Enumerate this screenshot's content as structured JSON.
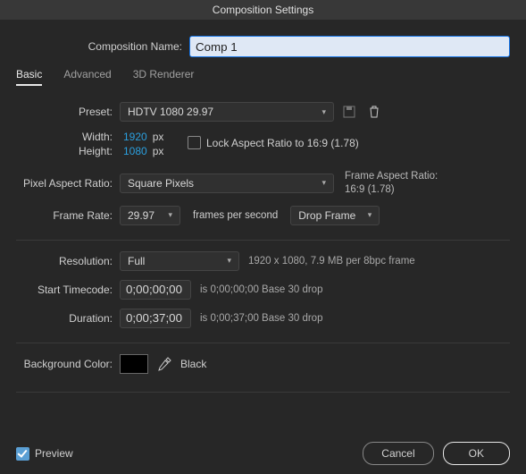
{
  "title": "Composition Settings",
  "compNameLabel": "Composition Name:",
  "compName": "Comp 1",
  "tabs": {
    "basic": "Basic",
    "advanced": "Advanced",
    "renderer": "3D Renderer"
  },
  "preset": {
    "label": "Preset:",
    "value": "HDTV 1080 29.97"
  },
  "width": {
    "label": "Width:",
    "value": "1920",
    "unit": "px"
  },
  "height": {
    "label": "Height:",
    "value": "1080",
    "unit": "px"
  },
  "lockAspect": "Lock Aspect Ratio to 16:9 (1.78)",
  "par": {
    "label": "Pixel Aspect Ratio:",
    "value": "Square Pixels"
  },
  "frameAspect": {
    "label": "Frame Aspect Ratio:",
    "value": "16:9 (1.78)"
  },
  "frameRate": {
    "label": "Frame Rate:",
    "value": "29.97",
    "unit": "frames per second",
    "drop": "Drop Frame"
  },
  "resolution": {
    "label": "Resolution:",
    "value": "Full",
    "info": "1920 x 1080, 7.9 MB per 8bpc frame"
  },
  "startTC": {
    "label": "Start Timecode:",
    "value": "0;00;00;00",
    "info": "is 0;00;00;00  Base 30  drop"
  },
  "duration": {
    "label": "Duration:",
    "value": "0;00;37;00",
    "info": "is 0;00;37;00  Base 30  drop"
  },
  "bg": {
    "label": "Background Color:",
    "name": "Black"
  },
  "preview": "Preview",
  "cancel": "Cancel",
  "ok": "OK"
}
